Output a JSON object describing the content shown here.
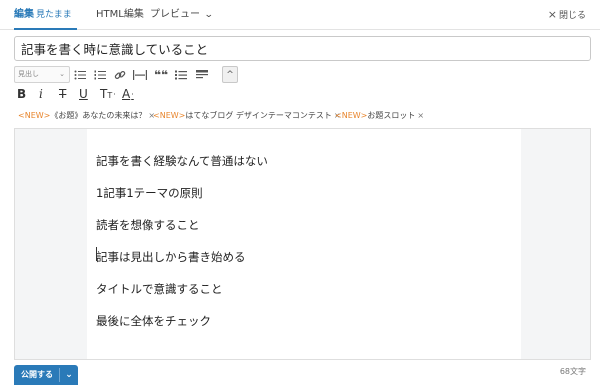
{
  "tabs": {
    "edit_label": "編集",
    "edit_mode": "見たまま",
    "html_label": "HTML編集",
    "preview_label": "プレビュー"
  },
  "close_label": "閉じる",
  "post": {
    "title": "記事を書く時に意識していること"
  },
  "toolbar": {
    "heading_select": "見出し",
    "bold": "B",
    "italic": "i",
    "strike": "T",
    "underline": "U",
    "font_size": "T",
    "font_color": "A",
    "quote": "❝❝",
    "collapse": "^"
  },
  "tags": [
    {
      "new": "<NEW>",
      "label": "《お題》あなたの未来は？"
    },
    {
      "new": "<NEW>",
      "label": "はてなブログ デザインテーマコンテスト"
    },
    {
      "new": "<NEW>",
      "label": "お題スロット"
    }
  ],
  "editor_lines": [
    "記事を書く経験なんて普通はない",
    "1記事1テーマの原則",
    "読者を想像すること",
    "記事は見出しから書き始める",
    "タイトルで意識すること",
    "最後に全体をチェック"
  ],
  "publish_label": "公開する",
  "char_count": "68文字",
  "colors": {
    "accent": "#2a7ab8",
    "new_tag": "#e8862e"
  }
}
